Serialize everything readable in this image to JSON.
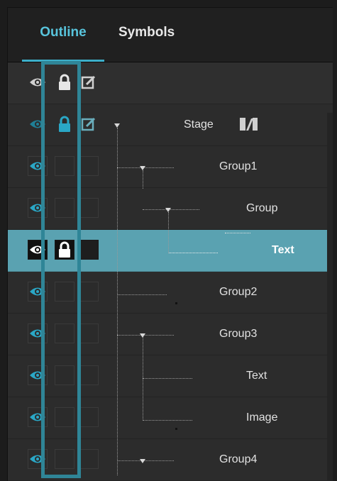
{
  "tabs": [
    {
      "label": "Outline",
      "active": true
    },
    {
      "label": "Symbols",
      "active": false
    }
  ],
  "colors": {
    "accent": "#3dafc9",
    "selection": "#5aa2b1",
    "highlight_border": "#2f8597",
    "eye_active": "#2aa7c6"
  },
  "header_row": {
    "icons": [
      "eye-icon",
      "lock-icon",
      "edit-icon"
    ]
  },
  "rows": [
    {
      "label": "Stage",
      "level": 0,
      "icons": [
        "eye-icon",
        "lock-icon",
        "edit-icon"
      ],
      "expand": true,
      "extra_icon": "stage-icon"
    },
    {
      "label": "Group1",
      "level": 1,
      "icons": [
        "eye-icon"
      ],
      "expand": true
    },
    {
      "label": "Group",
      "level": 2,
      "icons": [
        "eye-icon"
      ],
      "expand": true
    },
    {
      "label": "Text",
      "level": 3,
      "icons": [
        "eye-icon",
        "lock-icon"
      ],
      "selected": true
    },
    {
      "label": "Group2",
      "level": 1,
      "icons": [
        "eye-icon"
      ]
    },
    {
      "label": "Group3",
      "level": 1,
      "icons": [
        "eye-icon"
      ],
      "expand": true
    },
    {
      "label": "Text",
      "level": 2,
      "icons": [
        "eye-icon"
      ]
    },
    {
      "label": "Image",
      "level": 2,
      "icons": [
        "eye-icon"
      ]
    },
    {
      "label": "Group4",
      "level": 1,
      "icons": [
        "eye-icon"
      ],
      "expand": true
    }
  ]
}
